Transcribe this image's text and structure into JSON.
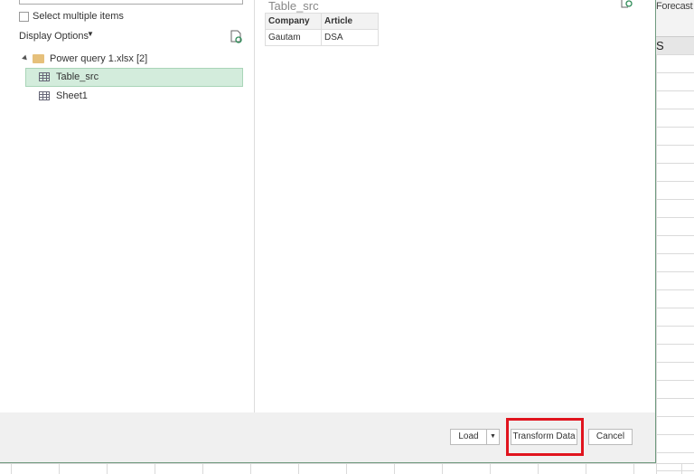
{
  "background": {
    "tab_partial": "Forecast",
    "column_header_partial": "S"
  },
  "navigator": {
    "select_multiple_label": "Select multiple items",
    "select_multiple_checked": false,
    "display_options_label": "Display Options",
    "tree": {
      "file": "Power query 1.xlsx [2]",
      "items": [
        {
          "label": "Table_src",
          "selected": true,
          "icon": "table-icon"
        },
        {
          "label": "Sheet1",
          "selected": false,
          "icon": "sheet-icon"
        }
      ]
    }
  },
  "preview": {
    "title": "Table_src",
    "columns": [
      "Company",
      "Article"
    ],
    "rows": [
      [
        "Gautam",
        "DSA"
      ]
    ]
  },
  "footer": {
    "load": "Load",
    "transform": "Transform Data",
    "cancel": "Cancel"
  },
  "colors": {
    "selection": "#d3ecdc",
    "highlight_box": "#e0141e"
  }
}
